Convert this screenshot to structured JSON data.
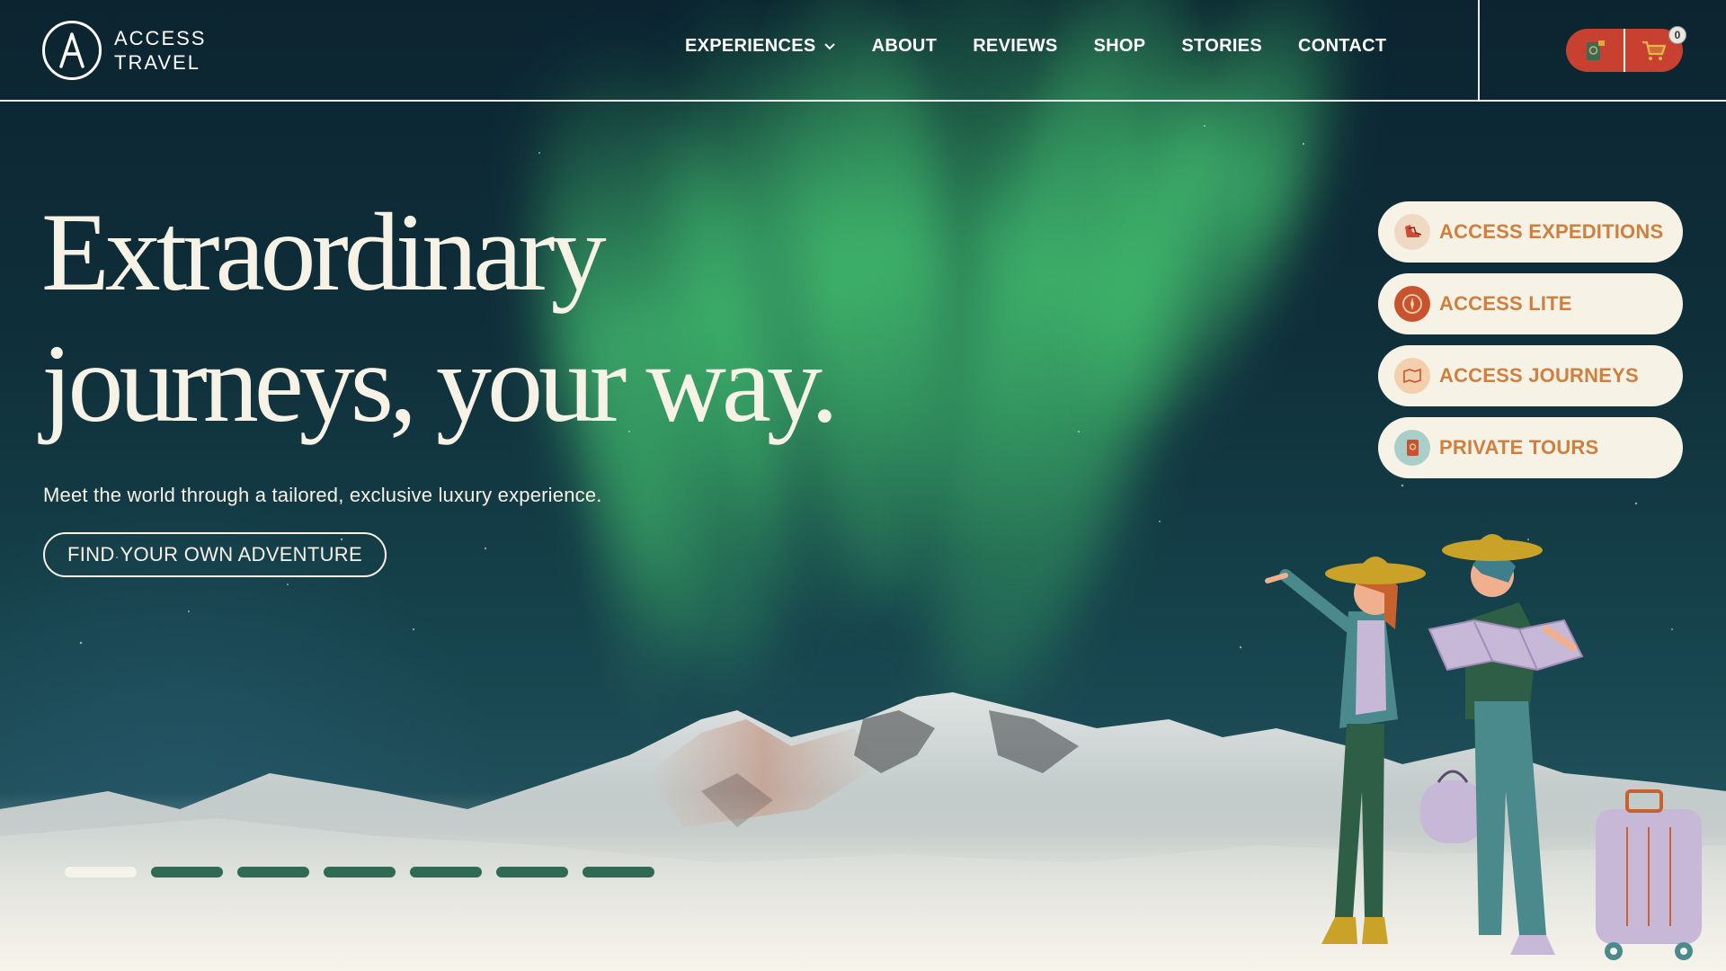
{
  "brand": {
    "line1": "ACCESS",
    "line2": "TRAVEL"
  },
  "nav": {
    "items": [
      {
        "label": "EXPERIENCES",
        "has_dropdown": true
      },
      {
        "label": "ABOUT"
      },
      {
        "label": "REVIEWS"
      },
      {
        "label": "SHOP"
      },
      {
        "label": "STORIES"
      },
      {
        "label": "CONTACT"
      }
    ]
  },
  "actions": {
    "cart_count": "0",
    "passport_icon": "passport-icon",
    "cart_icon": "cart-icon"
  },
  "hero": {
    "headline_line1": "Extraordinary",
    "headline_line2": "journeys, your way.",
    "subline": "Meet the world through a tailored, exclusive luxury experience.",
    "cta": "FIND YOUR OWN ADVENTURE"
  },
  "side_menu": [
    {
      "label": "ACCESS EXPEDITIONS",
      "icon": "boots-icon",
      "icon_bg": "#f0d9c3"
    },
    {
      "label": "ACCESS LITE",
      "icon": "compass-icon",
      "icon_bg": "#c8542f"
    },
    {
      "label": "ACCESS JOURNEYS",
      "icon": "map-icon",
      "icon_bg": "#f3cfae"
    },
    {
      "label": "PRIVATE TOURS",
      "icon": "passport-icon",
      "icon_bg": "#a9cfc8"
    }
  ],
  "slider": {
    "count": 7,
    "active_index": 0
  },
  "colors": {
    "accent_red": "#c8402f",
    "side_label": "#cf7f3e",
    "cream": "#f7f2e6",
    "dot_inactive": "#2f6a55"
  }
}
